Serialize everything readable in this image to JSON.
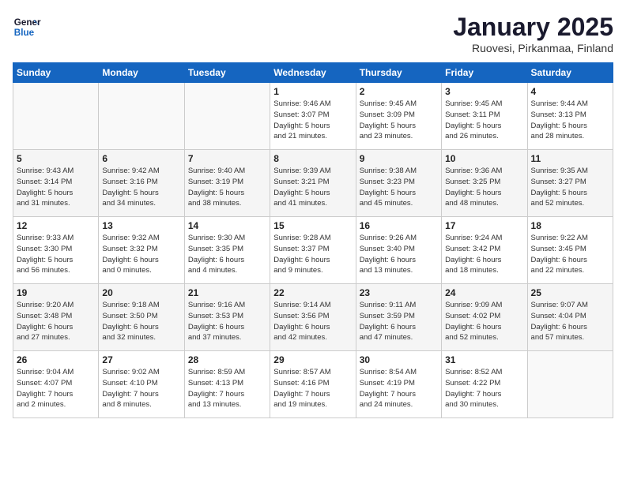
{
  "logo": {
    "line1": "General",
    "line2": "Blue"
  },
  "title": "January 2025",
  "subtitle": "Ruovesi, Pirkanmaa, Finland",
  "days_of_week": [
    "Sunday",
    "Monday",
    "Tuesday",
    "Wednesday",
    "Thursday",
    "Friday",
    "Saturday"
  ],
  "weeks": [
    [
      {
        "day": "",
        "detail": ""
      },
      {
        "day": "",
        "detail": ""
      },
      {
        "day": "",
        "detail": ""
      },
      {
        "day": "1",
        "detail": "Sunrise: 9:46 AM\nSunset: 3:07 PM\nDaylight: 5 hours\nand 21 minutes."
      },
      {
        "day": "2",
        "detail": "Sunrise: 9:45 AM\nSunset: 3:09 PM\nDaylight: 5 hours\nand 23 minutes."
      },
      {
        "day": "3",
        "detail": "Sunrise: 9:45 AM\nSunset: 3:11 PM\nDaylight: 5 hours\nand 26 minutes."
      },
      {
        "day": "4",
        "detail": "Sunrise: 9:44 AM\nSunset: 3:13 PM\nDaylight: 5 hours\nand 28 minutes."
      }
    ],
    [
      {
        "day": "5",
        "detail": "Sunrise: 9:43 AM\nSunset: 3:14 PM\nDaylight: 5 hours\nand 31 minutes."
      },
      {
        "day": "6",
        "detail": "Sunrise: 9:42 AM\nSunset: 3:16 PM\nDaylight: 5 hours\nand 34 minutes."
      },
      {
        "day": "7",
        "detail": "Sunrise: 9:40 AM\nSunset: 3:19 PM\nDaylight: 5 hours\nand 38 minutes."
      },
      {
        "day": "8",
        "detail": "Sunrise: 9:39 AM\nSunset: 3:21 PM\nDaylight: 5 hours\nand 41 minutes."
      },
      {
        "day": "9",
        "detail": "Sunrise: 9:38 AM\nSunset: 3:23 PM\nDaylight: 5 hours\nand 45 minutes."
      },
      {
        "day": "10",
        "detail": "Sunrise: 9:36 AM\nSunset: 3:25 PM\nDaylight: 5 hours\nand 48 minutes."
      },
      {
        "day": "11",
        "detail": "Sunrise: 9:35 AM\nSunset: 3:27 PM\nDaylight: 5 hours\nand 52 minutes."
      }
    ],
    [
      {
        "day": "12",
        "detail": "Sunrise: 9:33 AM\nSunset: 3:30 PM\nDaylight: 5 hours\nand 56 minutes."
      },
      {
        "day": "13",
        "detail": "Sunrise: 9:32 AM\nSunset: 3:32 PM\nDaylight: 6 hours\nand 0 minutes."
      },
      {
        "day": "14",
        "detail": "Sunrise: 9:30 AM\nSunset: 3:35 PM\nDaylight: 6 hours\nand 4 minutes."
      },
      {
        "day": "15",
        "detail": "Sunrise: 9:28 AM\nSunset: 3:37 PM\nDaylight: 6 hours\nand 9 minutes."
      },
      {
        "day": "16",
        "detail": "Sunrise: 9:26 AM\nSunset: 3:40 PM\nDaylight: 6 hours\nand 13 minutes."
      },
      {
        "day": "17",
        "detail": "Sunrise: 9:24 AM\nSunset: 3:42 PM\nDaylight: 6 hours\nand 18 minutes."
      },
      {
        "day": "18",
        "detail": "Sunrise: 9:22 AM\nSunset: 3:45 PM\nDaylight: 6 hours\nand 22 minutes."
      }
    ],
    [
      {
        "day": "19",
        "detail": "Sunrise: 9:20 AM\nSunset: 3:48 PM\nDaylight: 6 hours\nand 27 minutes."
      },
      {
        "day": "20",
        "detail": "Sunrise: 9:18 AM\nSunset: 3:50 PM\nDaylight: 6 hours\nand 32 minutes."
      },
      {
        "day": "21",
        "detail": "Sunrise: 9:16 AM\nSunset: 3:53 PM\nDaylight: 6 hours\nand 37 minutes."
      },
      {
        "day": "22",
        "detail": "Sunrise: 9:14 AM\nSunset: 3:56 PM\nDaylight: 6 hours\nand 42 minutes."
      },
      {
        "day": "23",
        "detail": "Sunrise: 9:11 AM\nSunset: 3:59 PM\nDaylight: 6 hours\nand 47 minutes."
      },
      {
        "day": "24",
        "detail": "Sunrise: 9:09 AM\nSunset: 4:02 PM\nDaylight: 6 hours\nand 52 minutes."
      },
      {
        "day": "25",
        "detail": "Sunrise: 9:07 AM\nSunset: 4:04 PM\nDaylight: 6 hours\nand 57 minutes."
      }
    ],
    [
      {
        "day": "26",
        "detail": "Sunrise: 9:04 AM\nSunset: 4:07 PM\nDaylight: 7 hours\nand 2 minutes."
      },
      {
        "day": "27",
        "detail": "Sunrise: 9:02 AM\nSunset: 4:10 PM\nDaylight: 7 hours\nand 8 minutes."
      },
      {
        "day": "28",
        "detail": "Sunrise: 8:59 AM\nSunset: 4:13 PM\nDaylight: 7 hours\nand 13 minutes."
      },
      {
        "day": "29",
        "detail": "Sunrise: 8:57 AM\nSunset: 4:16 PM\nDaylight: 7 hours\nand 19 minutes."
      },
      {
        "day": "30",
        "detail": "Sunrise: 8:54 AM\nSunset: 4:19 PM\nDaylight: 7 hours\nand 24 minutes."
      },
      {
        "day": "31",
        "detail": "Sunrise: 8:52 AM\nSunset: 4:22 PM\nDaylight: 7 hours\nand 30 minutes."
      },
      {
        "day": "",
        "detail": ""
      }
    ]
  ]
}
